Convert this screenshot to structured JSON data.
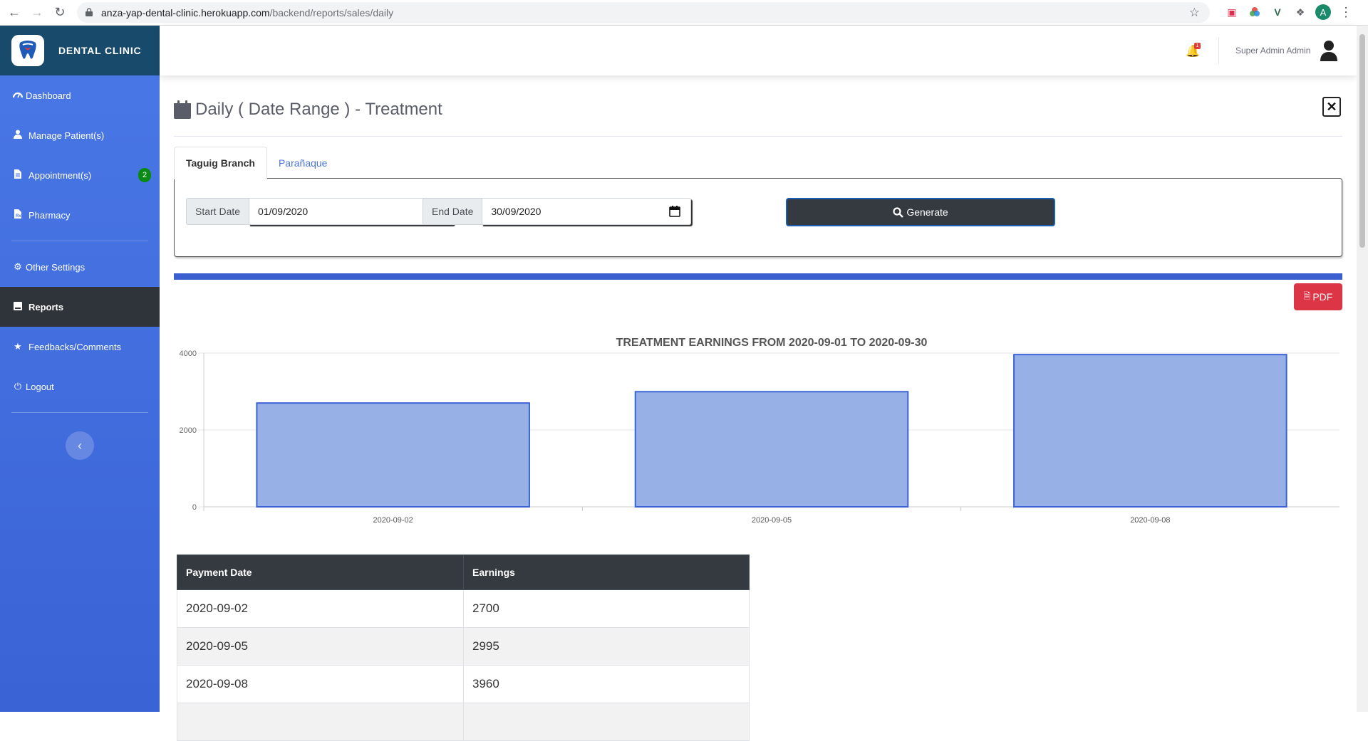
{
  "browser": {
    "url_host": "anza-yap-dental-clinic.herokuapp.com",
    "url_path": "/backend/reports/sales/daily",
    "profile_initial": "A"
  },
  "sidebar": {
    "brand": "DENTAL CLINIC",
    "items": [
      {
        "label": "Dashboard",
        "icon": "tachometer-icon"
      },
      {
        "label": "Manage Patient(s)",
        "icon": "user-injured-icon"
      },
      {
        "label": "Appointment(s)",
        "icon": "file-icon",
        "badge": "2"
      },
      {
        "label": "Pharmacy",
        "icon": "prescription-icon"
      },
      {
        "label": "Other Settings",
        "icon": "cogs-icon"
      },
      {
        "label": "Reports",
        "icon": "book-icon",
        "active": true
      },
      {
        "label": "Feedbacks/Comments",
        "icon": "star-icon"
      },
      {
        "label": "Logout",
        "icon": "power-icon"
      }
    ]
  },
  "topbar": {
    "notification_count": "1",
    "user_name": "Super Admin Admin"
  },
  "page": {
    "title": "Daily ( Date Range ) - Treatment",
    "tabs": [
      {
        "label": "Taguig Branch",
        "active": true
      },
      {
        "label": "Parañaque",
        "active": false
      }
    ],
    "filter": {
      "start_label": "Start Date",
      "start_value": "01/09/2020",
      "end_label": "End Date",
      "end_value": "30/09/2020",
      "generate_label": "Generate"
    },
    "pdf_label": "PDF"
  },
  "chart_data": {
    "type": "bar",
    "title": "TREATMENT EARNINGS FROM 2020-09-01 TO 2020-09-30",
    "categories": [
      "2020-09-02",
      "2020-09-05",
      "2020-09-08"
    ],
    "values": [
      2700,
      2995,
      3960
    ],
    "ylim": [
      0,
      4000
    ],
    "yticks": [
      0,
      2000,
      4000
    ],
    "grid": true,
    "bar_color": "#97b1e6",
    "bar_border": "#3b63d6"
  },
  "table": {
    "headers": [
      "Payment Date",
      "Earnings"
    ],
    "rows": [
      [
        "2020-09-02",
        "2700"
      ],
      [
        "2020-09-05",
        "2995"
      ],
      [
        "2020-09-08",
        "3960"
      ]
    ]
  }
}
